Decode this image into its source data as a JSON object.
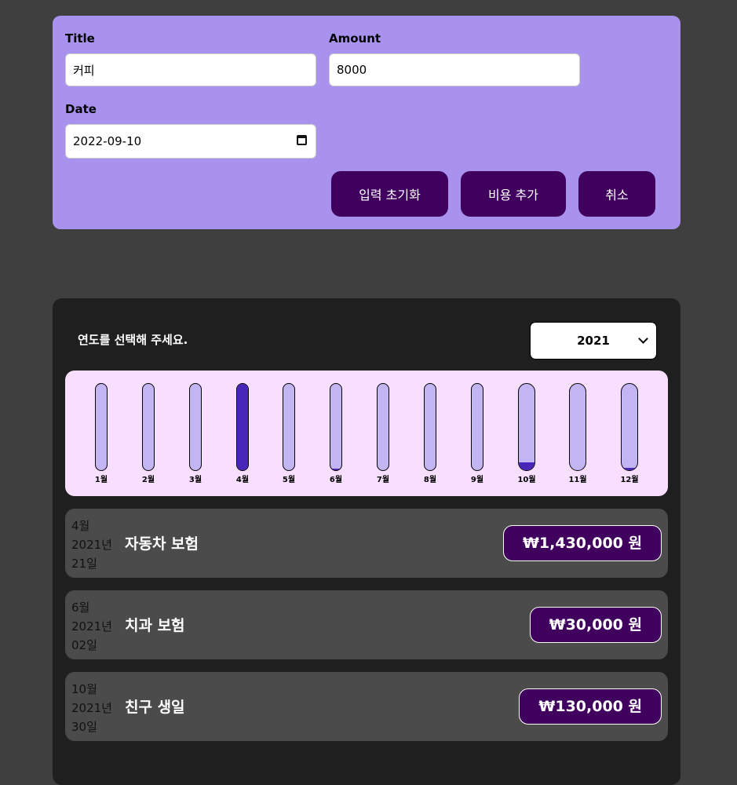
{
  "form": {
    "title_label": "Title",
    "title_value": "커피",
    "amount_label": "Amount",
    "amount_value": "8000",
    "date_label": "Date",
    "date_value": "2022-09-10",
    "reset_button": "입력 초기화",
    "add_button": "비용 추가",
    "cancel_button": "취소"
  },
  "filter": {
    "label": "연도를 선택해 주세요.",
    "selected_year": "2021"
  },
  "chart_data": {
    "type": "bar",
    "categories": [
      "1월",
      "2월",
      "3월",
      "4월",
      "5월",
      "6월",
      "7월",
      "8월",
      "9월",
      "10월",
      "11월",
      "12월"
    ],
    "values": [
      0,
      0,
      0,
      1,
      0,
      0.02,
      0,
      0,
      0,
      0.09,
      0,
      0.03
    ]
  },
  "expenses": [
    {
      "month": "4월",
      "year": "2021년",
      "day": "21일",
      "title": "자동차 보험",
      "price": "₩1,430,000 원"
    },
    {
      "month": "6월",
      "year": "2021년",
      "day": "02일",
      "title": "치과 보험",
      "price": "₩30,000 원"
    },
    {
      "month": "10월",
      "year": "2021년",
      "day": "30일",
      "title": "친구 생일",
      "price": "₩130,000 원"
    }
  ]
}
